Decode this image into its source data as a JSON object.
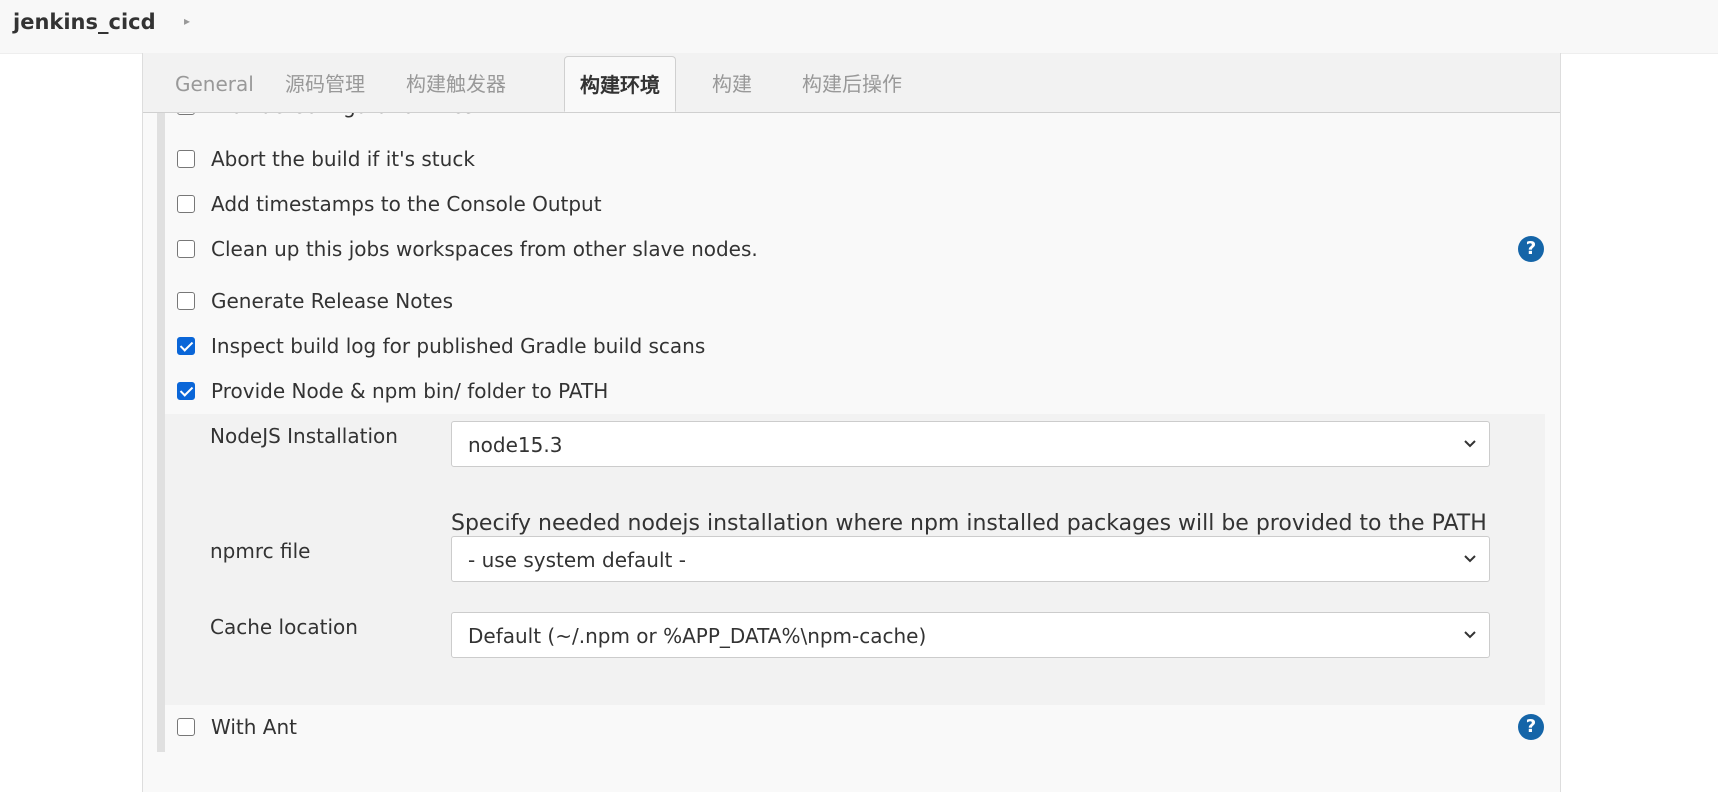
{
  "header": {
    "job_name": "jenkins_cicd",
    "chevron_icon": "chevron-right-icon"
  },
  "tabs": [
    {
      "label": "General",
      "active": false
    },
    {
      "label": "源码管理",
      "active": false
    },
    {
      "label": "构建触发器",
      "active": false
    },
    {
      "label": "构建环境",
      "active": true
    },
    {
      "label": "构建",
      "active": false
    },
    {
      "label": "构建后操作",
      "active": false
    }
  ],
  "options": {
    "partially_hidden": {
      "label": "Provide Configuration files",
      "checked": false
    },
    "abort_stuck": {
      "label": "Abort the build if it's stuck",
      "checked": false
    },
    "timestamps": {
      "label": "Add timestamps to the Console Output",
      "checked": false
    },
    "cleanup_workspaces": {
      "label": "Clean up this jobs workspaces from other slave nodes.",
      "checked": false
    },
    "release_notes": {
      "label": "Generate Release Notes",
      "checked": false
    },
    "gradle_scans": {
      "label": "Inspect build log for published Gradle build scans",
      "checked": true
    },
    "node_path": {
      "label": "Provide Node & npm bin/ folder to PATH",
      "checked": true
    },
    "with_ant": {
      "label": "With Ant",
      "checked": false
    }
  },
  "node_config": {
    "installation_label": "NodeJS Installation",
    "installation_value": "node15.3",
    "installation_description": "Specify needed nodejs installation where npm installed packages will be provided to the PATH",
    "npmrc_label": "npmrc file",
    "npmrc_value": "- use system default -",
    "cache_label": "Cache location",
    "cache_value": "Default (~/.npm or %APP_DATA%\\npm-cache)"
  },
  "help_icon_glyph": "?",
  "colors": {
    "accent": "#1565a8",
    "checkbox_checked": "#0a66d8",
    "panel_bg": "#f9f9f9"
  }
}
